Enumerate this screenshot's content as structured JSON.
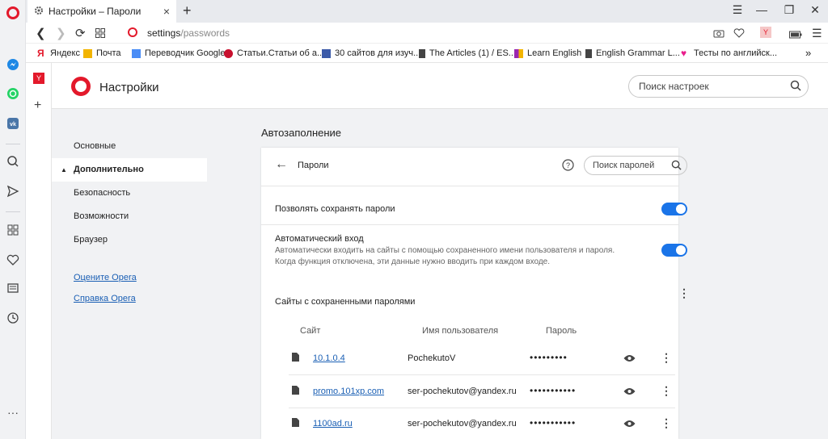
{
  "tab": {
    "title": "Настройки – Пароли",
    "close": "×",
    "new": "+"
  },
  "window_controls": {
    "min": "—",
    "max": "❐",
    "close": "✕",
    "menu": "☰"
  },
  "address": {
    "host": "settings",
    "path": "/passwords"
  },
  "bookmarks": [
    {
      "label": "Яндекс",
      "color": "#e3192b"
    },
    {
      "label": "Почта",
      "color": "#f2b400"
    },
    {
      "label": "Переводчик Google",
      "color": "#4a8df6"
    },
    {
      "label": "Статьи.Статьи об а...",
      "color": "#c8102e"
    },
    {
      "label": "30 сайтов для изуч...",
      "color": "#3b5aa8"
    },
    {
      "label": "The Articles (1) / ES...",
      "color": "#444444"
    },
    {
      "label": "Learn English",
      "color": "#9b27b0"
    },
    {
      "label": "English Grammar L...",
      "color": "#444444"
    },
    {
      "label": "Тесты по английск...",
      "color": "#e91e8c"
    }
  ],
  "bookmarks_more": "»",
  "header": {
    "title": "Настройки",
    "search_placeholder": "Поиск настроек"
  },
  "nav": {
    "items": [
      "Основные",
      "Дополнительно",
      "Безопасность",
      "Возможности",
      "Браузер"
    ],
    "links": [
      "Оцените Opera",
      "Справка Opera"
    ]
  },
  "main": {
    "section_title": "Автозаполнение",
    "passwords_title": "Пароли",
    "search_placeholder": "Поиск паролей",
    "allow_save_label": "Позволять сохранять пароли",
    "allow_save_on": true,
    "autologin_title": "Автоматический вход",
    "autologin_desc_1": "Автоматически входить на сайты с помощью сохраненного имени пользователя и пароля.",
    "autologin_desc_2": "Когда функция отключена, эти данные нужно вводить при каждом входе.",
    "autologin_on": true,
    "saved_title": "Сайты с сохраненными паролями",
    "col_site": "Сайт",
    "col_user": "Имя пользователя",
    "col_pass": "Пароль",
    "rows": [
      {
        "site": "10.1.0.4",
        "user": "PochekutoV",
        "pass": "•••••••••"
      },
      {
        "site": "promo.101xp.com",
        "user": "ser-pochekutov@yandex.ru",
        "pass": "•••••••••••"
      },
      {
        "site": "1100ad.ru",
        "user": "ser-pochekutov@yandex.ru",
        "pass": "•••••••••••"
      }
    ]
  },
  "accent": "#1a74e8",
  "opera_red": "#e3192b"
}
